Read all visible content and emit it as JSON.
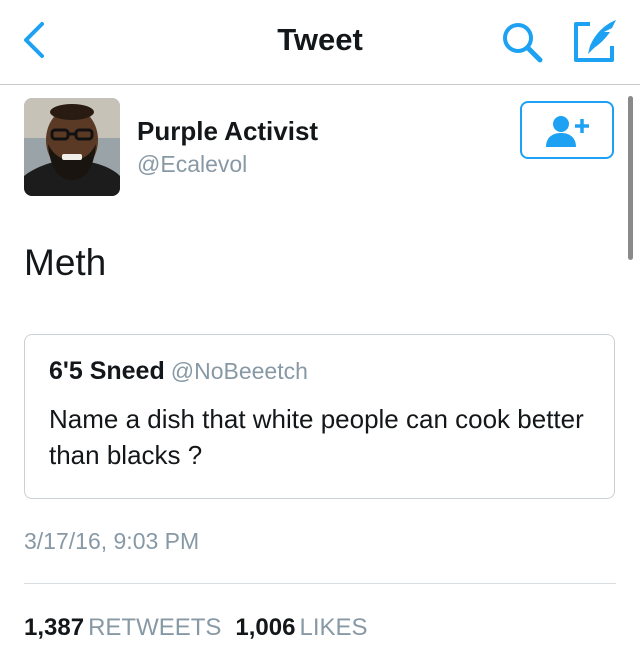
{
  "nav": {
    "title": "Tweet",
    "back_icon": "chevron-left-icon",
    "search_icon": "search-icon",
    "compose_icon": "compose-tweet-icon"
  },
  "tweet": {
    "author_name": "Purple Activist",
    "author_handle": "@Ecalevol",
    "follow_icon": "add-user-icon",
    "text": "Meth",
    "quoted": {
      "author_name": "6'5 Sneed",
      "author_handle": "@NoBeeetch",
      "text": "Name a dish that white people can cook better than blacks ?"
    },
    "timestamp": "3/17/16, 9:03 PM",
    "retweets_count": "1,387",
    "retweets_label": "RETWEETS",
    "likes_count": "1,006",
    "likes_label": "LIKES"
  },
  "colors": {
    "accent": "#1da1f2",
    "secondary_text": "#8899a6",
    "primary_text": "#14171a",
    "border": "#c9d0d6"
  }
}
